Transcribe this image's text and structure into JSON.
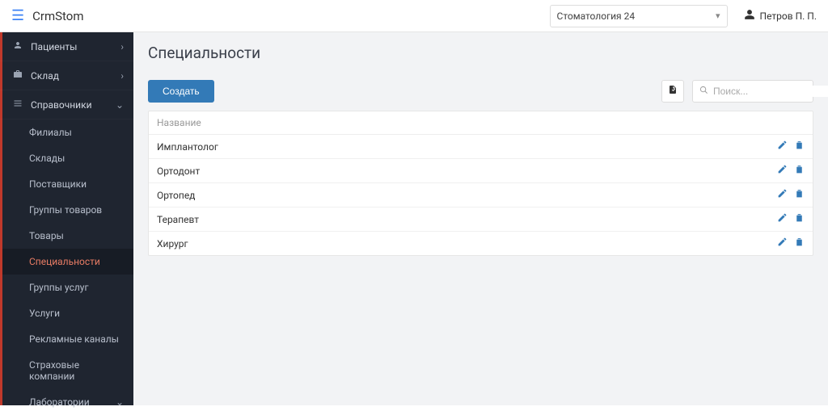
{
  "header": {
    "brand": "CrmStom",
    "clinic_selected": "Стоматология 24",
    "user_name": "Петров П. П."
  },
  "sidebar": {
    "items": [
      {
        "icon": "patients",
        "label": "Пациенты",
        "chev": "right"
      },
      {
        "icon": "warehouse",
        "label": "Склад",
        "chev": "right"
      },
      {
        "icon": "ref",
        "label": "Справочники",
        "chev": "down"
      }
    ],
    "sub_items": [
      {
        "label": "Филиалы",
        "active": false
      },
      {
        "label": "Склады",
        "active": false
      },
      {
        "label": "Поставщики",
        "active": false
      },
      {
        "label": "Группы товаров",
        "active": false
      },
      {
        "label": "Товары",
        "active": false
      },
      {
        "label": "Специальности",
        "active": true
      },
      {
        "label": "Группы услуг",
        "active": false
      },
      {
        "label": "Услуги",
        "active": false
      },
      {
        "label": "Рекламные каналы",
        "active": false
      },
      {
        "label": "Страховые компании",
        "active": false
      },
      {
        "label": "Лаборатории",
        "active": false,
        "chev": "down"
      }
    ]
  },
  "page": {
    "title": "Специальности",
    "create_label": "Создать",
    "search_placeholder": "Поиск...",
    "table_header": "Название",
    "rows": [
      {
        "name": "Имплантолог"
      },
      {
        "name": "Ортодонт"
      },
      {
        "name": "Ортопед"
      },
      {
        "name": "Терапевт"
      },
      {
        "name": "Хирург"
      }
    ]
  }
}
